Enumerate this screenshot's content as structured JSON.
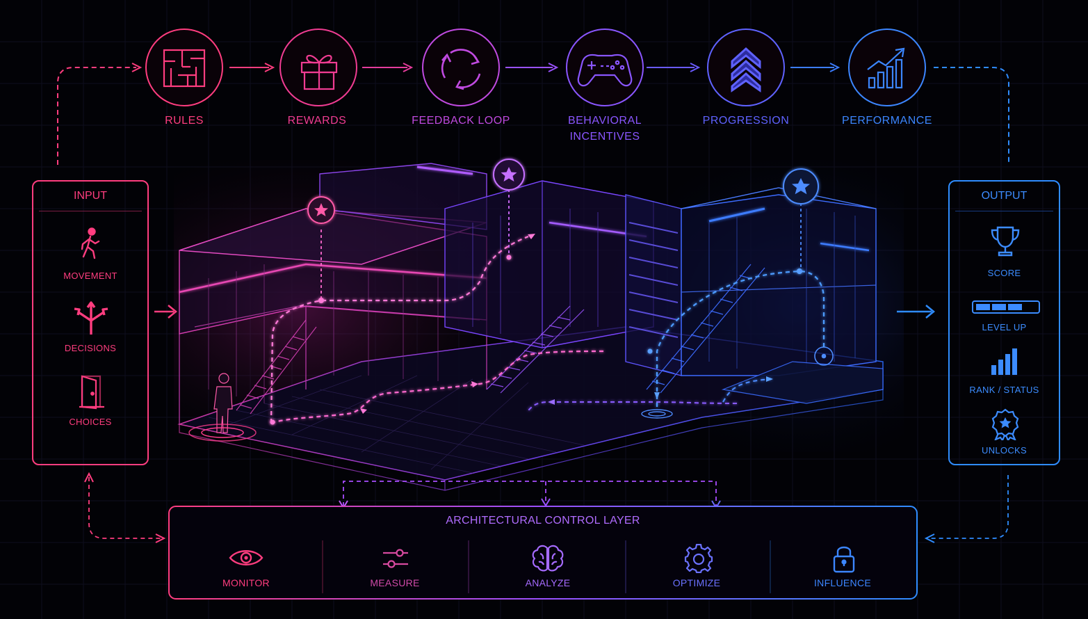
{
  "flow_steps": [
    {
      "label": "RULES",
      "icon": "maze-icon"
    },
    {
      "label": "REWARDS",
      "icon": "gift-icon"
    },
    {
      "label": "FEEDBACK LOOP",
      "icon": "cycle-arrows-icon"
    },
    {
      "label": "BEHAVIORAL",
      "label2": "INCENTIVES",
      "icon": "gamepad-icon"
    },
    {
      "label": "PROGRESSION",
      "icon": "chevrons-up-icon"
    },
    {
      "label": "PERFORMANCE",
      "icon": "growth-chart-icon"
    }
  ],
  "input_panel": {
    "title": "INPUT",
    "items": [
      {
        "label": "MOVEMENT",
        "icon": "walking-person-icon"
      },
      {
        "label": "DECISIONS",
        "icon": "branching-arrows-icon"
      },
      {
        "label": "CHOICES",
        "icon": "door-icon"
      }
    ]
  },
  "output_panel": {
    "title": "OUTPUT",
    "items": [
      {
        "label": "SCORE",
        "icon": "trophy-icon"
      },
      {
        "label": "LEVEL UP",
        "icon": "progress-bar-icon"
      },
      {
        "label": "RANK / STATUS",
        "icon": "bar-rank-icon"
      },
      {
        "label": "UNLOCKS",
        "icon": "badge-star-icon"
      }
    ]
  },
  "control_layer": {
    "title": "ARCHITECTURAL CONTROL LAYER",
    "items": [
      {
        "label": "MONITOR",
        "icon": "eye-icon"
      },
      {
        "label": "MEASURE",
        "icon": "sliders-icon"
      },
      {
        "label": "ANALYZE",
        "icon": "brain-icon"
      },
      {
        "label": "OPTIMIZE",
        "icon": "gear-icon"
      },
      {
        "label": "INFLUENCE",
        "icon": "lock-icon"
      }
    ]
  },
  "colors": {
    "background": "#020206",
    "pink": "#ff3d7f",
    "magenta": "#d94bd9",
    "purple": "#9a57ff",
    "indigo": "#6a5bff",
    "blue": "#3c7dff",
    "cyan_blue": "#2f9bff"
  }
}
